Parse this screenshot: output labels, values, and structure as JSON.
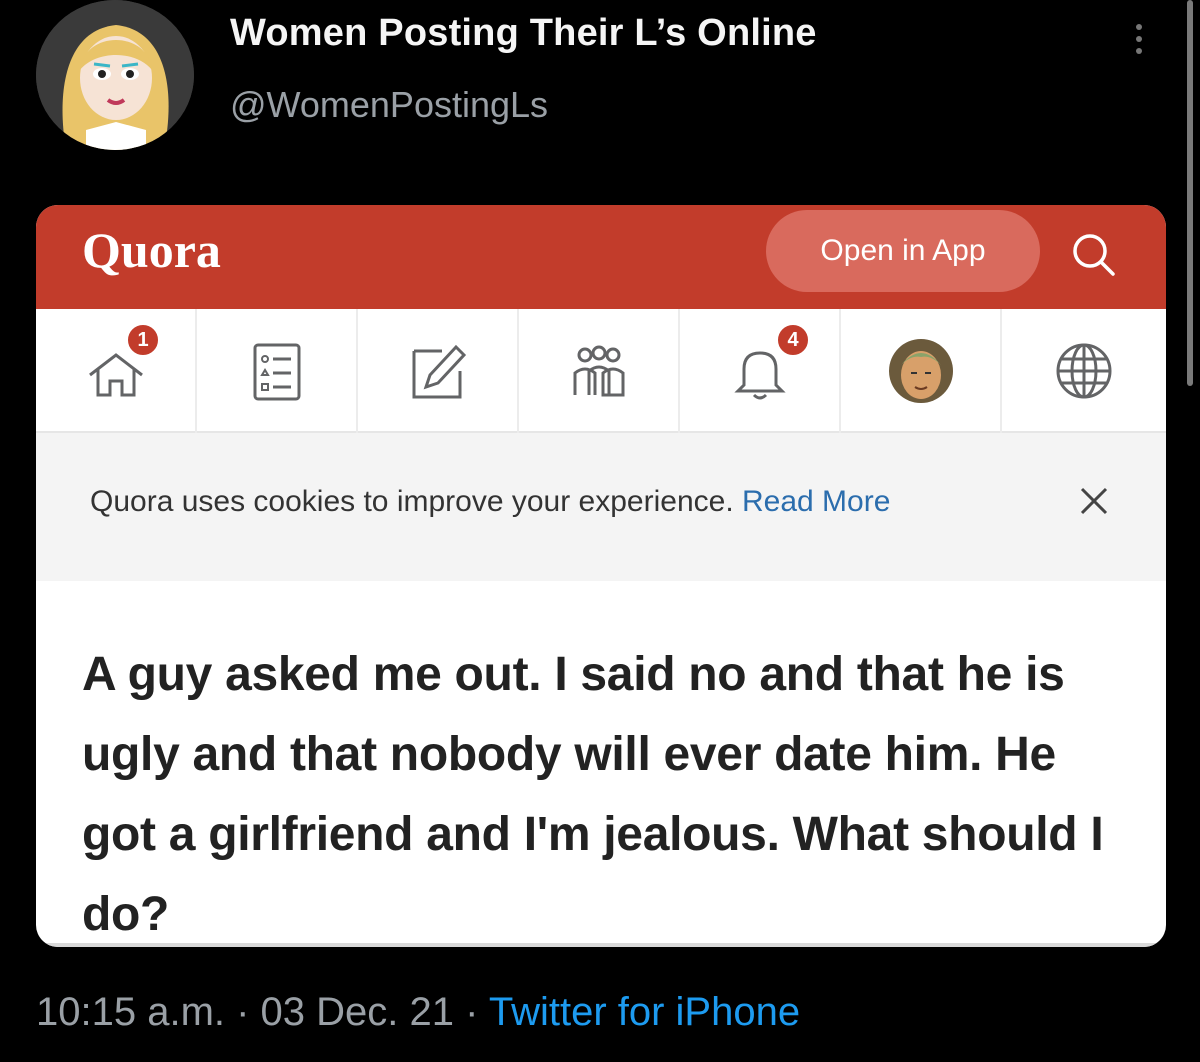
{
  "tweet": {
    "display_name": "Women Posting Their L’s Online",
    "handle": "@WomenPostingLs",
    "timestamp": "10:15 a.m. · 03 Dec. 21 · ",
    "source": "Twitter for iPhone"
  },
  "quora": {
    "logo": "Quora",
    "open_in_app": "Open in App",
    "nav": {
      "home_badge": "1",
      "notifications_badge": "4"
    },
    "cookie_text": "Quora uses cookies to improve your experience. ",
    "cookie_link": "Read More",
    "question": "A guy asked me out. I said no and that he is ugly and that nobody will ever date him. He got a girlfriend and I'm jealous. What should I do?"
  },
  "icons": [
    "avatar",
    "more-icon",
    "search-icon",
    "home-icon",
    "answer-icon",
    "pencil-icon",
    "spaces-icon",
    "bell-icon",
    "profile-avatar",
    "globe-icon",
    "close-icon"
  ],
  "colors": {
    "quora_red": "#c23c2b",
    "twitter_blue": "#1d9bf0",
    "link_blue": "#2b6dad"
  }
}
